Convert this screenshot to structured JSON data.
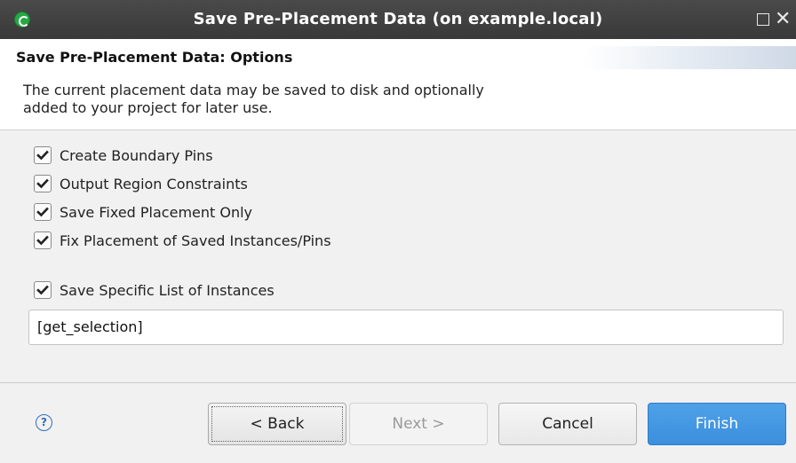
{
  "window": {
    "title": "Save Pre-Placement Data  (on example.local)",
    "maximize_icon": "maximize-icon",
    "close_icon": "close-icon",
    "close_glyph": "✕"
  },
  "header": {
    "heading": "Save Pre-Placement Data: Options",
    "description_line1": "The current placement data may be saved to disk and optionally",
    "description_line2": "added to your project for later use."
  },
  "options": [
    {
      "label": "Create Boundary Pins",
      "checked": true
    },
    {
      "label": "Output Region Constraints",
      "checked": true
    },
    {
      "label": "Save Fixed Placement Only",
      "checked": true
    },
    {
      "label": "Fix Placement of Saved Instances/Pins",
      "checked": true
    },
    {
      "label": "Save Specific List of Instances",
      "checked": true
    }
  ],
  "instances_field": {
    "value": "[get_selection]"
  },
  "footer": {
    "help_glyph": "?",
    "back_label": "< Back",
    "next_label": "Next >",
    "cancel_label": "Cancel",
    "finish_label": "Finish",
    "next_enabled": false
  },
  "colors": {
    "titlebar": "#3f3f3f",
    "finish_button": "#3b8fdc",
    "help_icon": "#2c6fbd",
    "app_icon": "#27a844"
  }
}
